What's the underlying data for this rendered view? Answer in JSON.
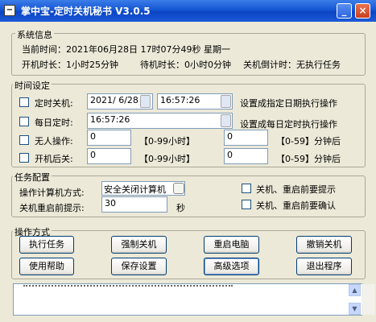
{
  "window": {
    "title": "掌中宝-定时关机秘书 V3.0.5",
    "sys_icon": "−",
    "minimize_glyph": "_",
    "close_glyph": "×"
  },
  "sysinfo": {
    "legend": "系统信息",
    "current_time": "当前时间：2021年06月28日 17时07分49秒 星期一",
    "uptime": "开机时长：1小时25分钟",
    "idle": "待机时长：0小时0分钟",
    "countdown": "关机倒计时：无执行任务"
  },
  "timeset": {
    "legend": "时间设定",
    "timed_shutdown_label": "定时关机:",
    "date_value": "2021/ 6/28",
    "time_value": "16:57:26",
    "date_hint": "设置成指定日期执行操作",
    "daily_label": "每日定时:",
    "daily_value": "16:57:26",
    "daily_hint": "设置成每日定时执行操作",
    "idle_label": "无人操作:",
    "idle_hours": "0",
    "idle_hours_unit": "【0-99小时】",
    "idle_minutes": "0",
    "idle_minutes_unit": "【0-59】分钟后",
    "after_boot_label": "开机后关:",
    "boot_hours": "0",
    "boot_hours_unit": "【0-99小时】",
    "boot_minutes": "0",
    "boot_minutes_unit": "【0-59】分钟后"
  },
  "taskcfg": {
    "legend": "任务配置",
    "mode_label": "操作计算机方式:",
    "mode_value": "安全关闭计算机",
    "prompt_label": "关机重启前提示:",
    "prompt_value": "30",
    "prompt_unit": "秒",
    "need_prompt": "关机、重启前要提示",
    "need_confirm": "关机、重启前要确认"
  },
  "ops": {
    "legend": "操作方式",
    "execute": "执行任务",
    "force_shutdown": "强制关机",
    "restart": "重启电脑",
    "cancel_shutdown": "撤销关机",
    "help": "使用帮助",
    "save": "保存设置",
    "advanced": "高级选项",
    "exit": "退出程序"
  },
  "colors": {
    "titlebar": "#0b45c4",
    "panel": "#ece9d8",
    "button_border": "#003c74"
  }
}
